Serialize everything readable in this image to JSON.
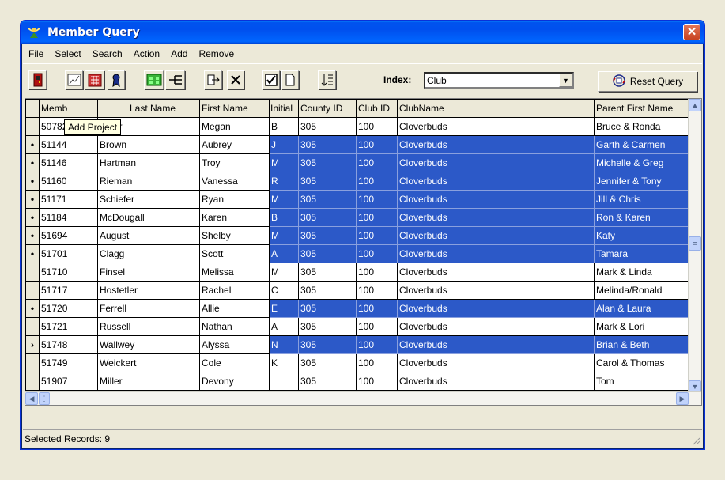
{
  "window": {
    "title": "Member Query"
  },
  "menu": [
    "File",
    "Select",
    "Search",
    "Action",
    "Add",
    "Remove"
  ],
  "toolbar": {
    "icons": [
      "exit-icon",
      "chart-icon",
      "calculator-icon",
      "ribbon-icon",
      "add-project-icon",
      "tree-icon",
      "export-icon",
      "delete-icon",
      "checkbox-icon",
      "page-icon",
      "sort-icon"
    ],
    "index_label": "Index:",
    "index_value": "Club",
    "reset_label": "Reset Query"
  },
  "tooltip": "Add Project",
  "grid": {
    "columns": [
      "Memb",
      "Last Name",
      "First Name",
      "Initial",
      "County ID",
      "Club ID",
      "ClubName",
      "Parent First Name"
    ],
    "rows": [
      {
        "marker": "",
        "selected": false,
        "cells": [
          "50782",
          "Ritter",
          "Megan",
          "B",
          "305",
          "100",
          "Cloverbuds",
          "Bruce & Ronda"
        ]
      },
      {
        "marker": "•",
        "selected": true,
        "cells": [
          "51144",
          "Brown",
          "Aubrey",
          "J",
          "305",
          "100",
          "Cloverbuds",
          "Garth & Carmen"
        ]
      },
      {
        "marker": "•",
        "selected": true,
        "cells": [
          "51146",
          "Hartman",
          "Troy",
          "M",
          "305",
          "100",
          "Cloverbuds",
          "Michelle & Greg"
        ]
      },
      {
        "marker": "•",
        "selected": true,
        "cells": [
          "51160",
          "Rieman",
          "Vanessa",
          "R",
          "305",
          "100",
          "Cloverbuds",
          "Jennifer & Tony"
        ]
      },
      {
        "marker": "•",
        "selected": true,
        "cells": [
          "51171",
          "Schiefer",
          "Ryan",
          "M",
          "305",
          "100",
          "Cloverbuds",
          "Jill & Chris"
        ]
      },
      {
        "marker": "•",
        "selected": true,
        "cells": [
          "51184",
          "McDougall",
          "Karen",
          "B",
          "305",
          "100",
          "Cloverbuds",
          "Ron & Karen"
        ]
      },
      {
        "marker": "•",
        "selected": true,
        "cells": [
          "51694",
          "August",
          "Shelby",
          "M",
          "305",
          "100",
          "Cloverbuds",
          "Katy"
        ]
      },
      {
        "marker": "•",
        "selected": true,
        "cells": [
          "51701",
          "Clagg",
          "Scott",
          "A",
          "305",
          "100",
          "Cloverbuds",
          "Tamara"
        ]
      },
      {
        "marker": "",
        "selected": false,
        "cells": [
          "51710",
          "Finsel",
          "Melissa",
          "M",
          "305",
          "100",
          "Cloverbuds",
          "Mark & Linda"
        ]
      },
      {
        "marker": "",
        "selected": false,
        "cells": [
          "51717",
          "Hostetler",
          "Rachel",
          "C",
          "305",
          "100",
          "Cloverbuds",
          "Melinda/Ronald"
        ]
      },
      {
        "marker": "•",
        "selected": true,
        "cells": [
          "51720",
          "Ferrell",
          "Allie",
          "E",
          "305",
          "100",
          "Cloverbuds",
          "Alan & Laura"
        ]
      },
      {
        "marker": "",
        "selected": false,
        "cells": [
          "51721",
          "Russell",
          "Nathan",
          "A",
          "305",
          "100",
          "Cloverbuds",
          "Mark & Lori"
        ]
      },
      {
        "marker": "›",
        "selected": true,
        "cells": [
          "51748",
          "Wallwey",
          "Alyssa",
          "N",
          "305",
          "100",
          "Cloverbuds",
          "Brian & Beth"
        ]
      },
      {
        "marker": "",
        "selected": false,
        "cells": [
          "51749",
          "Weickert",
          "Cole",
          "K",
          "305",
          "100",
          "Cloverbuds",
          "Carol & Thomas"
        ]
      },
      {
        "marker": "",
        "selected": false,
        "cells": [
          "51907",
          "Miller",
          "Devony",
          "",
          "305",
          "100",
          "Cloverbuds",
          "Tom"
        ]
      }
    ]
  },
  "status": {
    "text": "Selected Records: 9"
  },
  "colors": {
    "selection": "#2c59c8",
    "titlebar": "#0053ee",
    "face": "#ece9d8"
  }
}
